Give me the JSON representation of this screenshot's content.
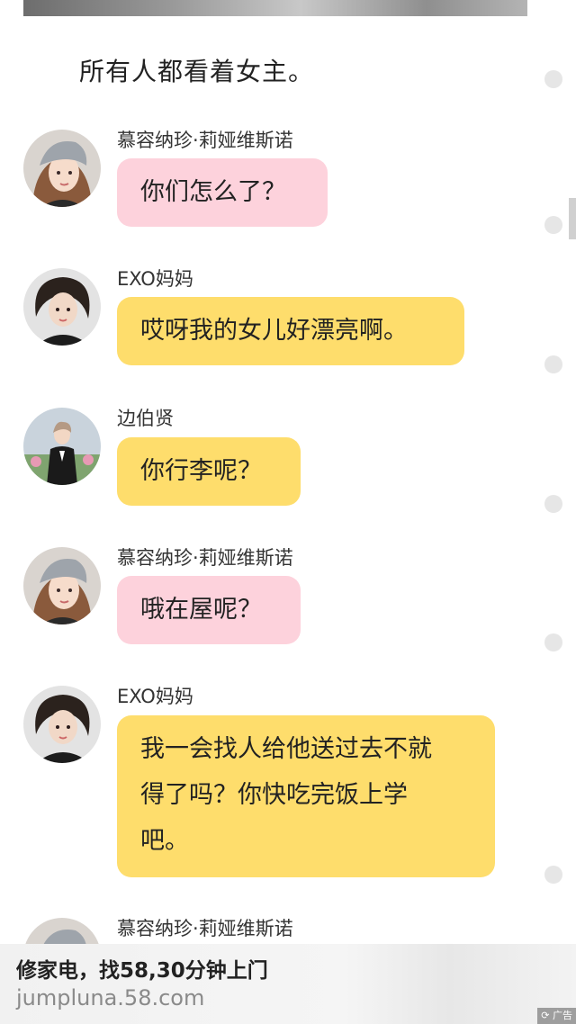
{
  "narration": "所有人都看着女主。",
  "colors": {
    "pink_bubble": "#fdd2dc",
    "yellow_bubble": "#fedd6c"
  },
  "messages": [
    {
      "sender": "慕容纳珍·莉娅维斯诺",
      "avatar_icon": "girl-grey-hat-avatar",
      "color": "pink",
      "lines": [
        "你们怎么了？"
      ]
    },
    {
      "sender": "EXO妈妈",
      "avatar_icon": "woman-short-hair-avatar",
      "color": "yellow",
      "lines": [
        "哎呀我的女儿好漂亮啊。"
      ]
    },
    {
      "sender": "边伯贤",
      "avatar_icon": "man-suit-avatar",
      "color": "yellow",
      "lines": [
        "你行李呢？"
      ]
    },
    {
      "sender": "慕容纳珍·莉娅维斯诺",
      "avatar_icon": "girl-grey-hat-avatar",
      "color": "pink",
      "lines": [
        "哦在屋呢？"
      ]
    },
    {
      "sender": "EXO妈妈",
      "avatar_icon": "woman-short-hair-avatar",
      "color": "yellow",
      "lines": [
        "我一会找人给他送过去不就",
        "得了吗？你快吃完饭上学",
        "吧。"
      ]
    },
    {
      "sender": "慕容纳珍·莉娅维斯诺",
      "avatar_icon": "girl-grey-hat-avatar"
    }
  ],
  "ad": {
    "title": "修家电，找58,30分钟上门",
    "url": "jumpluna.58.com",
    "badge": "广告",
    "badge_icon": "refresh-icon"
  }
}
